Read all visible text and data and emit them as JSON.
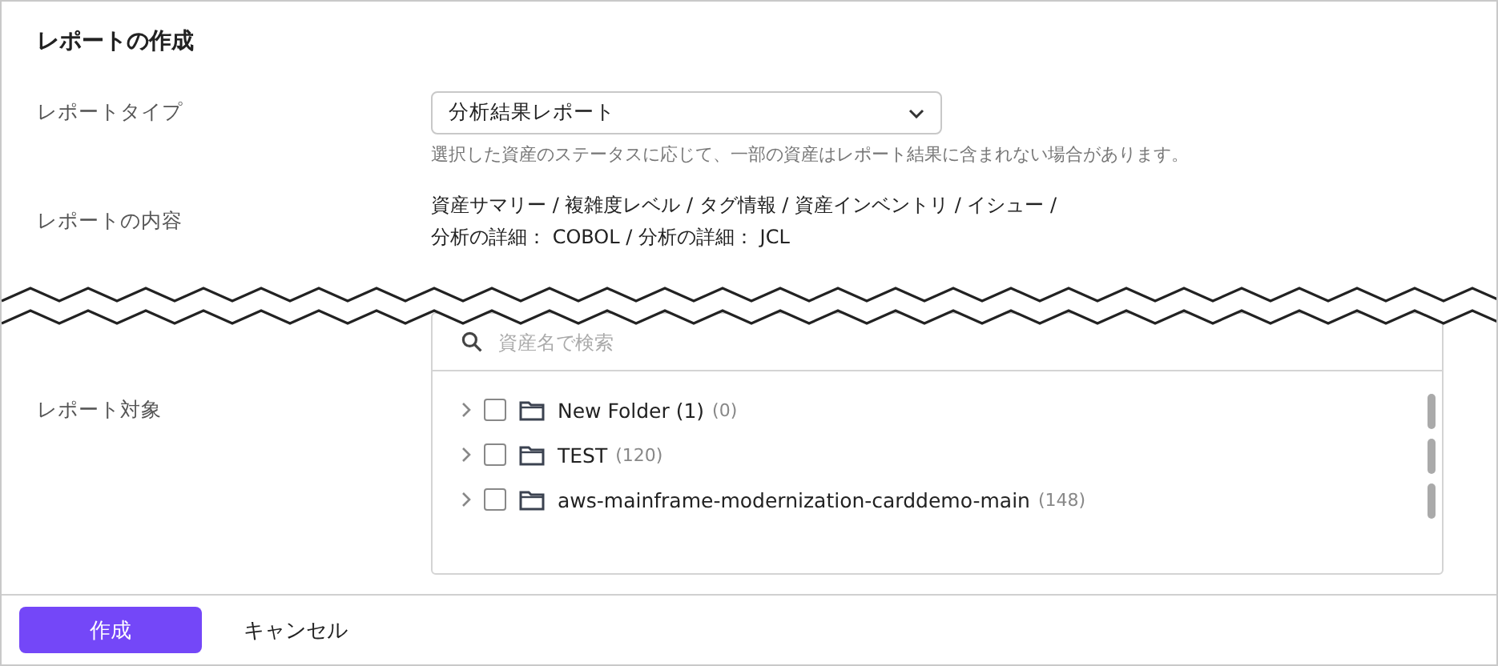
{
  "title": "レポートの作成",
  "report_type": {
    "label": "レポートタイプ",
    "value": "分析結果レポート",
    "hint": "選択した資産のステータスに応じて、一部の資産はレポート結果に含まれない場合があります。"
  },
  "report_content": {
    "label": "レポートの内容",
    "lines": [
      "資産サマリー / 複雑度レベル / タグ情報 / 資産インベントリ / イシュー /",
      "分析の詳細： COBOL / 分析の詳細： JCL"
    ]
  },
  "report_target": {
    "label": "レポート対象",
    "search": {
      "placeholder": "資産名で検索"
    },
    "items": [
      {
        "name": "New Folder (1)",
        "count": "(0)",
        "checked": false,
        "expanded": false
      },
      {
        "name": "TEST",
        "count": "(120)",
        "checked": false,
        "expanded": false
      },
      {
        "name": "aws-mainframe-modernization-carddemo-main",
        "count": "(148)",
        "checked": false,
        "expanded": false
      }
    ]
  },
  "buttons": {
    "primary": "作成",
    "secondary": "キャンセル"
  }
}
